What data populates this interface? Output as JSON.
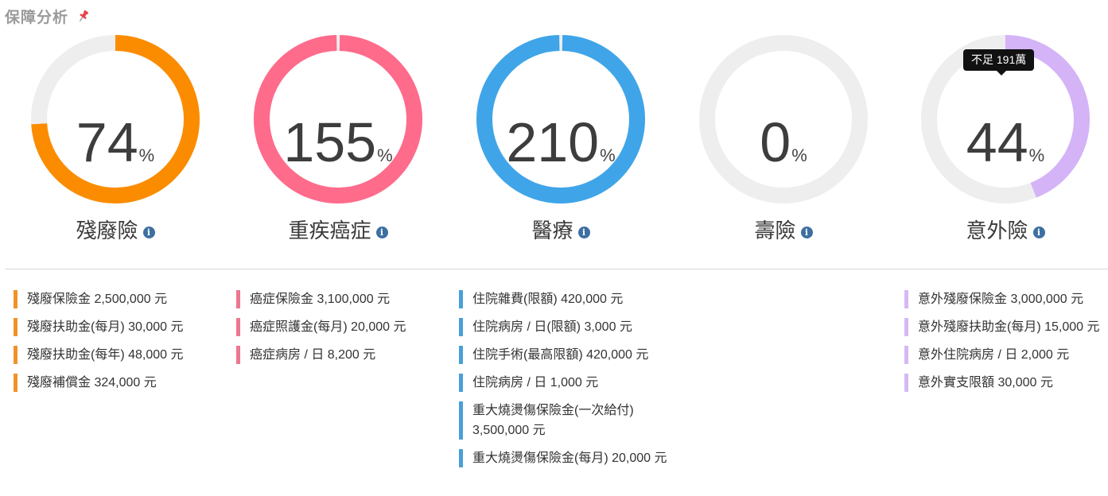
{
  "header": {
    "title": "保障分析",
    "pin_icon": "pushpin-icon"
  },
  "gauges": [
    {
      "key": "disability",
      "value": "74",
      "unit": "%",
      "label": "殘廢險",
      "percent": 74,
      "color": "#fb8c00",
      "track": "#eeeeee"
    },
    {
      "key": "cancer",
      "value": "155",
      "unit": "%",
      "label": "重疾癌症",
      "percent": 155,
      "color": "#ff6b8b",
      "track": "#eeeeee"
    },
    {
      "key": "medical",
      "value": "210",
      "unit": "%",
      "label": "醫療",
      "percent": 210,
      "color": "#3fa5e8",
      "track": "#eeeeee"
    },
    {
      "key": "life",
      "value": "0",
      "unit": "%",
      "label": "壽險",
      "percent": 0,
      "color": "#cccccc",
      "track": "#eeeeee"
    },
    {
      "key": "accident",
      "value": "44",
      "unit": "%",
      "label": "意外險",
      "percent": 44,
      "color": "#d4b3f7",
      "track": "#eeeeee"
    }
  ],
  "tooltip": {
    "text": "不足 191萬"
  },
  "details": [
    {
      "color": "#f0922a",
      "items": [
        "殘廢保險金 2,500,000 元",
        "殘廢扶助金(每月) 30,000 元",
        "殘廢扶助金(每年) 48,000 元",
        "殘廢補償金 324,000 元"
      ]
    },
    {
      "color": "#ec7791",
      "items": [
        "癌症保險金 3,100,000 元",
        "癌症照護金(每月) 20,000 元",
        "癌症病房 / 日 8,200 元"
      ]
    },
    {
      "color": "#48a0d8",
      "items": [
        "住院雜費(限額) 420,000 元",
        "住院病房 / 日(限額) 3,000 元",
        "住院手術(最高限額) 420,000 元",
        "住院病房 / 日 1,000 元",
        "重大燒燙傷保險金(一次給付) 3,500,000 元",
        "重大燒燙傷保險金(每月) 20,000 元"
      ]
    },
    {
      "color": "#cccccc",
      "items": []
    },
    {
      "color": "#d6b8f5",
      "items": [
        "意外殘廢保險金 3,000,000 元",
        "意外殘廢扶助金(每月) 15,000 元",
        "意外住院病房 / 日 2,000 元",
        "意外實支限額 30,000 元"
      ]
    }
  ]
}
